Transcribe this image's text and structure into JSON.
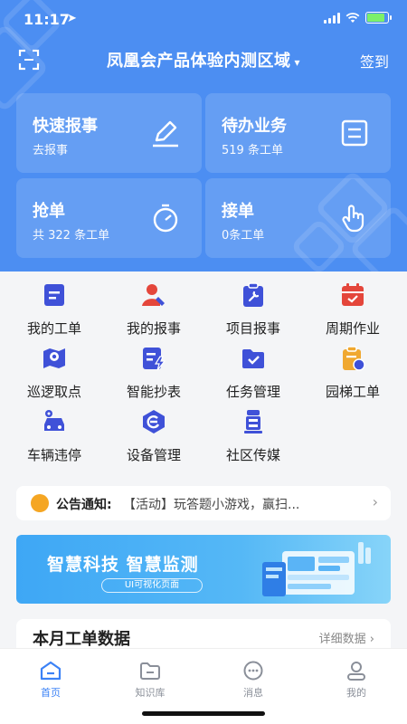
{
  "status_bar": {
    "time": "11:17",
    "battery_level": 0.85
  },
  "nav": {
    "title": "凤凰会产品体验内测区域",
    "checkin": "签到"
  },
  "quick_cards": [
    {
      "title": "快速报事",
      "subtitle": "去报事",
      "icon": "pencil-icon"
    },
    {
      "title": "待办业务",
      "subtitle": "519 条工单",
      "icon": "document-icon"
    },
    {
      "title": "抢单",
      "subtitle": "共 322 条工单",
      "icon": "stopwatch-icon"
    },
    {
      "title": "接单",
      "subtitle": "0条工单",
      "icon": "hand-pointer-icon"
    }
  ],
  "grid": [
    {
      "label": "我的工单",
      "icon": "work-order-icon",
      "color": "#3f51d8"
    },
    {
      "label": "我的报事",
      "icon": "report-user-icon",
      "color": "#e4463b"
    },
    {
      "label": "项目报事",
      "icon": "clipboard-wrench-icon",
      "color": "#3f51d8"
    },
    {
      "label": "周期作业",
      "icon": "calendar-icon",
      "color": "#e4463b"
    },
    {
      "label": "巡逻取点",
      "icon": "map-pin-icon",
      "color": "#3f51d8"
    },
    {
      "label": "智能抄表",
      "icon": "meter-bolt-icon",
      "color": "#3f51d8"
    },
    {
      "label": "任务管理",
      "icon": "folder-check-icon",
      "color": "#3f51d8"
    },
    {
      "label": "园梯工单",
      "icon": "clipboard-coin-icon",
      "color": "#f0a830"
    },
    {
      "label": "车辆违停",
      "icon": "car-pin-icon",
      "color": "#3f51d8"
    },
    {
      "label": "设备管理",
      "icon": "device-hexagon-icon",
      "color": "#3f51d8"
    },
    {
      "label": "社区传媒",
      "icon": "media-tower-icon",
      "color": "#3f51d8"
    }
  ],
  "notice": {
    "label": "公告通知:",
    "text": "【活动】玩答题小游戏，赢扫..."
  },
  "banner": {
    "title": "智慧科技 智慧监测",
    "subtitle": "UI可视化页面"
  },
  "stats": {
    "title": "本月工单数据",
    "link": "详细数据"
  },
  "tabs": [
    {
      "label": "首页",
      "icon": "home-icon",
      "active": true
    },
    {
      "label": "知识库",
      "icon": "folder-icon",
      "active": false
    },
    {
      "label": "消息",
      "icon": "chat-icon",
      "active": false
    },
    {
      "label": "我的",
      "icon": "user-icon",
      "active": false
    }
  ],
  "colors": {
    "header": "#4c8ef2",
    "accent": "#3b82f6",
    "icon_blue": "#3f51d8",
    "icon_red": "#e4463b",
    "icon_orange": "#f0a830"
  }
}
